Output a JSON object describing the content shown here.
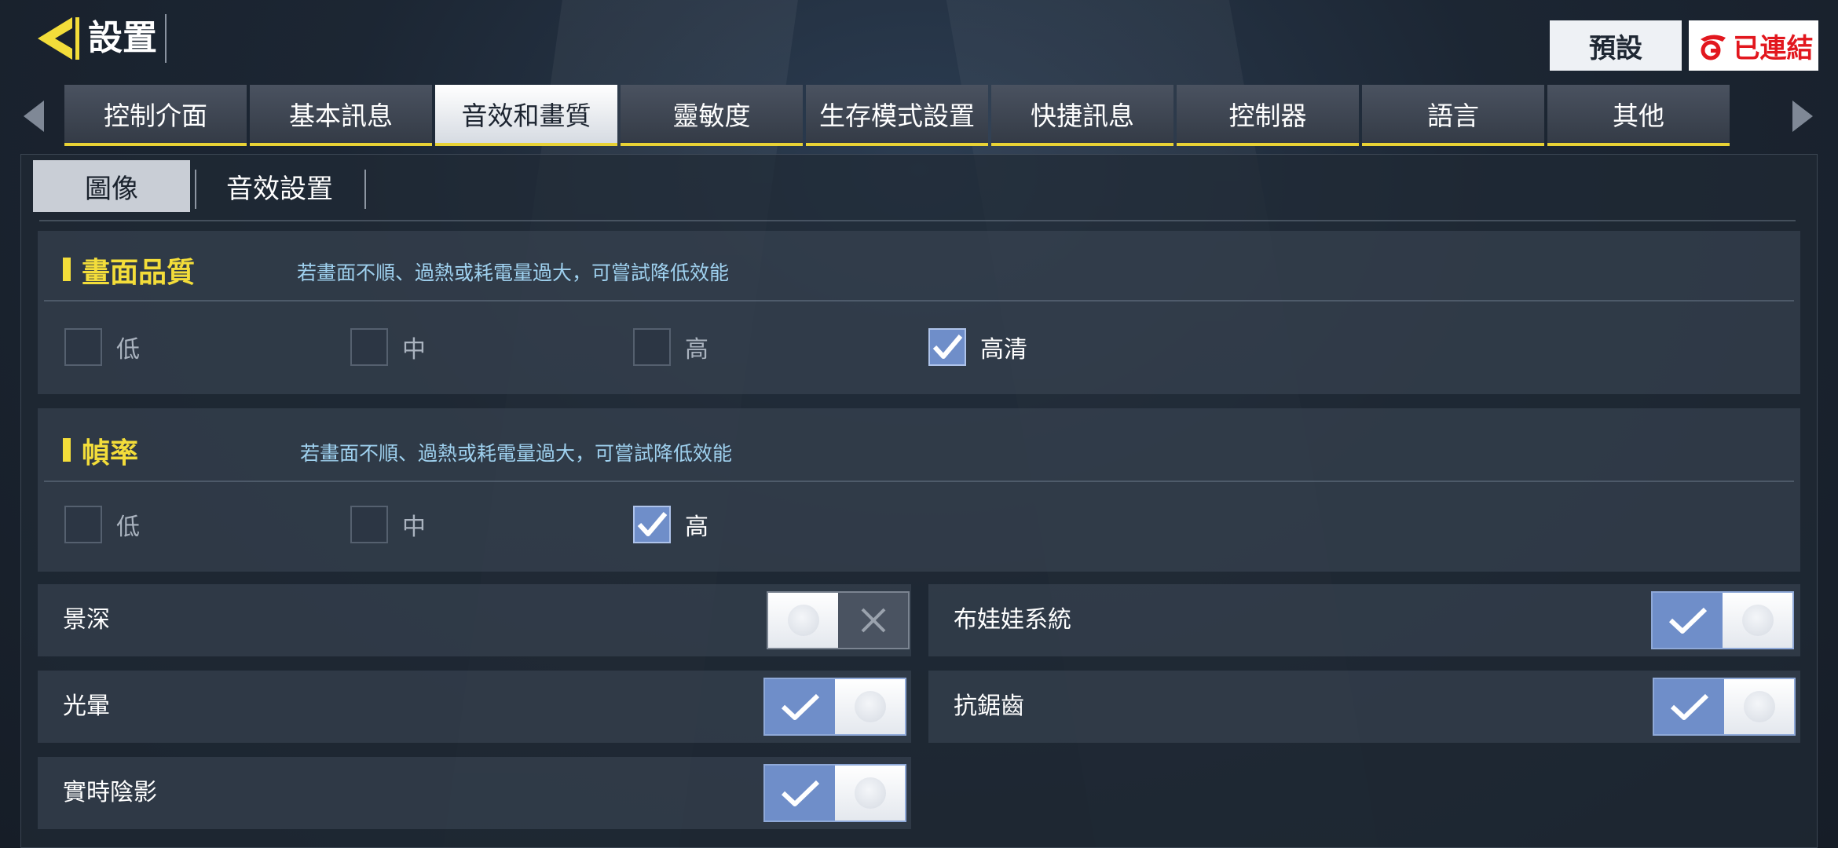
{
  "header": {
    "title": "設置",
    "preset_label": "預設",
    "linked_label": "已連結"
  },
  "tabs": [
    {
      "label": "控制介面",
      "active": false
    },
    {
      "label": "基本訊息",
      "active": false
    },
    {
      "label": "音效和畫質",
      "active": true
    },
    {
      "label": "靈敏度",
      "active": false
    },
    {
      "label": "生存模式設置",
      "active": false
    },
    {
      "label": "快捷訊息",
      "active": false
    },
    {
      "label": "控制器",
      "active": false
    },
    {
      "label": "語言",
      "active": false
    },
    {
      "label": "其他",
      "active": false
    }
  ],
  "subtabs": [
    {
      "label": "圖像",
      "active": true
    },
    {
      "label": "音效設置",
      "active": false
    }
  ],
  "quality": {
    "title": "畫面品質",
    "hint": "若畫面不順、過熱或耗電量過大，可嘗試降低效能",
    "options": [
      {
        "label": "低",
        "checked": false
      },
      {
        "label": "中",
        "checked": false
      },
      {
        "label": "高",
        "checked": false
      },
      {
        "label": "高清",
        "checked": true
      }
    ]
  },
  "framerate": {
    "title": "幀率",
    "hint": "若畫面不順、過熱或耗電量過大，可嘗試降低效能",
    "options": [
      {
        "label": "低",
        "checked": false
      },
      {
        "label": "中",
        "checked": false
      },
      {
        "label": "高",
        "checked": true
      }
    ]
  },
  "toggles": {
    "depth_of_field": {
      "label": "景深",
      "on": false
    },
    "bloom": {
      "label": "光暈",
      "on": true
    },
    "realtime_shadows": {
      "label": "實時陰影",
      "on": true
    },
    "ragdoll": {
      "label": "布娃娃系統",
      "on": true
    },
    "anti_aliasing": {
      "label": "抗鋸齒",
      "on": true
    }
  },
  "colors": {
    "accent_yellow": "#f3dd3a",
    "toggle_on": "#6f8ec9",
    "hint_blue": "#9fd1ef",
    "linked_red": "#e2171e"
  }
}
